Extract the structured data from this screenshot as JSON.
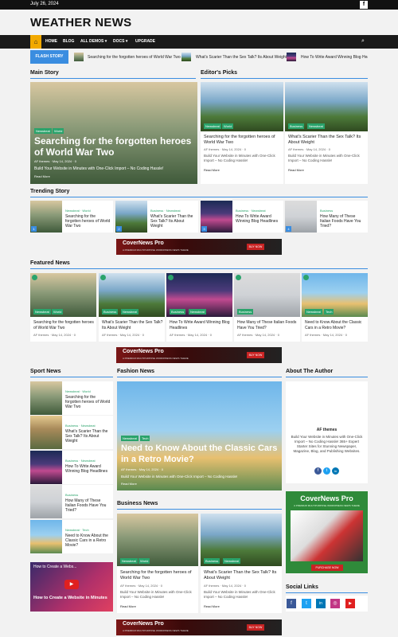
{
  "topbar": {
    "date": "July 26, 2024",
    "fb": "f"
  },
  "brand": {
    "title": "WEATHER NEWS"
  },
  "nav": {
    "items": [
      "HOME",
      "BLOG",
      "ALL DEMOS ▾",
      "DOCS ▾",
      "UPGRADE"
    ],
    "home_icon": "⌂",
    "search_icon": "⌕"
  },
  "flash": {
    "label": "FLASH STORY",
    "items": [
      "Searching for the forgotten heroes of World War Two",
      "What's Scarier Than the Sex Talk? Its About Weight",
      "How To Write Award Winning Blog Headlines"
    ]
  },
  "main_story": {
    "heading": "Main Story",
    "tags": [
      "Newsbeat",
      "World"
    ],
    "title": "Searching for the forgotten heroes of World War Two",
    "author": "AF themes",
    "date": "May 14, 2024",
    "comments": "0",
    "excerpt": "Build Your Website in Minutes with One-Click Import – No Coding Hassle!",
    "read_more": "Read More"
  },
  "editors": {
    "heading": "Editor's Picks",
    "items": [
      {
        "tags": [
          "Newsbeat",
          "World"
        ],
        "title": "Searching for the forgotten heroes of World War Two",
        "author": "AF themes",
        "date": "May 14, 2024",
        "comments": "0",
        "excerpt": "Build Your Website in Minutes with One-Click Import – No Coding Hassle!",
        "read_more": "Read More"
      },
      {
        "tags": [
          "Business",
          "Newsbeat"
        ],
        "title": "What's Scarier Than the Sex Talk? Its About Weight",
        "author": "AF themes",
        "date": "May 14, 2024",
        "comments": "0",
        "excerpt": "Build Your Website in Minutes with One-Click Import – No Coding Hassle!",
        "read_more": "Read More"
      }
    ]
  },
  "trending": {
    "heading": "Trending Story",
    "items": [
      {
        "tags": "Newsbeat · World",
        "title": "Searching for the forgotten heroes of World War Two",
        "num": "1"
      },
      {
        "tags": "Business · Newsbeat",
        "title": "What's Scarier Than the Sex Talk? Its About Weight",
        "num": "2"
      },
      {
        "tags": "Business · Newsbeat",
        "title": "How To Write Award Winning Blog Headlines",
        "num": "3"
      },
      {
        "tags": "Business",
        "title": "How Many of These Italian Foods Have You Tried?",
        "num": "4"
      }
    ]
  },
  "ad": {
    "title": "CoverNews Pro",
    "sub": "A PREMIUM MULTIPURPOSE WORDPRESS NEWS THEME",
    "btn": "BUY NOW"
  },
  "featured": {
    "heading": "Featured News",
    "items": [
      {
        "tags": [
          "Newsbeat",
          "World"
        ],
        "title": "Searching for the forgotten heroes of World War Two",
        "author": "AF themes",
        "date": "May 14, 2024",
        "comments": "0"
      },
      {
        "tags": [
          "Business",
          "Newsbeat"
        ],
        "title": "What's Scarier Than the Sex Talk? Its About Weight",
        "author": "AF themes",
        "date": "May 14, 2024",
        "comments": "0"
      },
      {
        "tags": [
          "Business",
          "Newsbeat"
        ],
        "title": "How To Write Award Winning Blog Headlines",
        "author": "AF themes",
        "date": "May 14, 2024",
        "comments": "0"
      },
      {
        "tags": [
          "Business"
        ],
        "title": "How Many of These Italian Foods Have You Tried?",
        "author": "AF themes",
        "date": "May 14, 2024",
        "comments": "0"
      },
      {
        "tags": [
          "Newsbeat",
          "Tech"
        ],
        "title": "Need to Know About the Classic Cars in a Retro Movie?",
        "author": "AF themes",
        "date": "May 14, 2024",
        "comments": "0"
      }
    ]
  },
  "sport": {
    "heading": "Sport News",
    "items": [
      {
        "tags": "Newsbeat · World",
        "title": "Searching for the forgotten heroes of World War Two"
      },
      {
        "tags": "Business · Newsbeat",
        "title": "What's Scarier Than the Sex Talk? Its About Weight"
      },
      {
        "tags": "Business · Newsbeat",
        "title": "How To Write Award Winning Blog Headlines"
      },
      {
        "tags": "Business",
        "title": "How Many of These Italian Foods Have You Tried?"
      },
      {
        "tags": "Newsbeat · Tech",
        "title": "Need to Know About the Classic Cars in a Retro Movie?"
      }
    ],
    "video_title": "How to Create a Webs...",
    "video_caption": "How to Create a Website in Minutes"
  },
  "fashion": {
    "heading": "Fashion News",
    "tags": [
      "Newsbeat",
      "Tech"
    ],
    "title": "Need to Know About the Classic Cars in a Retro Movie?",
    "author": "AF themes",
    "date": "May 14, 2024",
    "comments": "0",
    "excerpt": "Build Your Website in Minutes with One-Click Import – No Coding Hassle!",
    "read_more": "Read More"
  },
  "business": {
    "heading": "Business News",
    "items": [
      {
        "tags": [
          "Newsbeat",
          "World"
        ],
        "title": "Searching for the forgotten heroes of World War Two",
        "author": "AF themes",
        "date": "May 14, 2024",
        "comments": "0",
        "excerpt": "Build Your Website in Minutes with One-Click Import – No Coding Hassle!",
        "read_more": "Read More"
      },
      {
        "tags": [
          "Business",
          "Newsbeat"
        ],
        "title": "What's Scarier Than the Sex Talk? Its About Weight",
        "author": "AF themes",
        "date": "May 14, 2024",
        "comments": "0",
        "excerpt": "Build Your Website in Minutes with One-Click Import – No Coding Hassle!",
        "read_more": "Read More"
      }
    ]
  },
  "about": {
    "heading": "About The Author",
    "name": "AF themes",
    "text": "Build Your Website in Minutes with One-Click Import – No Coding Hassle! 365+ Expert Starter Sites for Stunning Newspaper, Magazine, Blog, and Publishing Websites.",
    "social": [
      "f",
      "t",
      "in"
    ]
  },
  "sidebar_ad": {
    "title": "CoverNews Pro",
    "sub": "A PREMIUM MULTIPURPOSE WORDPRESS NEWS THEME",
    "btn": "PURCHASE NOW"
  },
  "social": {
    "heading": "Social Links",
    "icons": [
      "f",
      "t",
      "in",
      "◎",
      "▶"
    ]
  },
  "colors": {
    "accent": "#3a8de0",
    "tag": "#2aa36b",
    "home": "#f2a900"
  }
}
